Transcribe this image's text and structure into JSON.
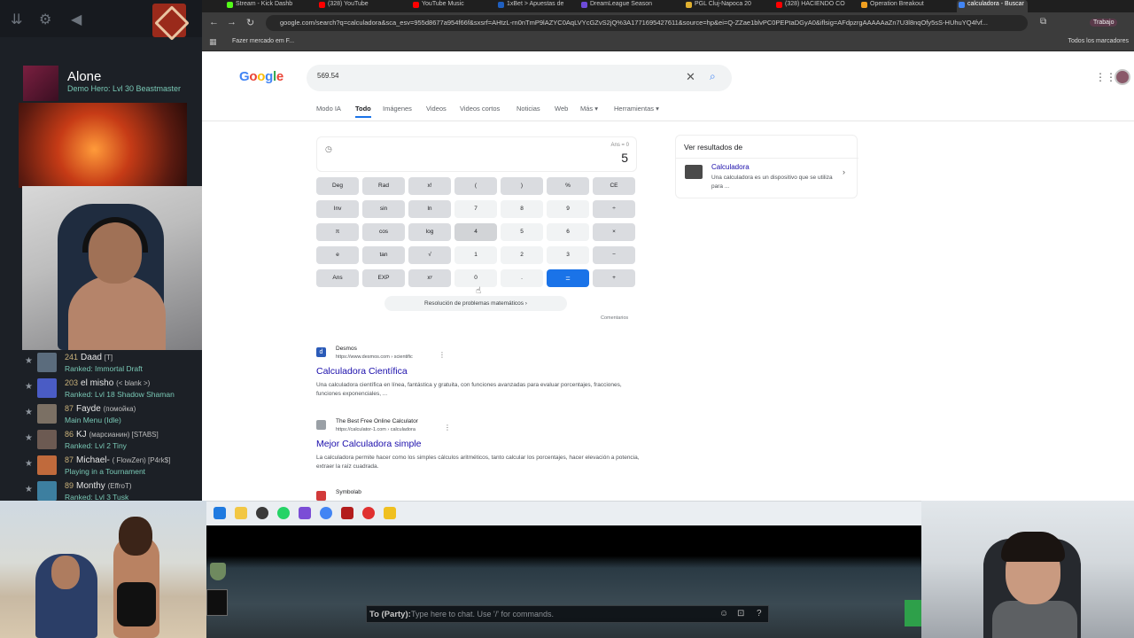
{
  "steam": {
    "profile": {
      "name": "Alone",
      "status": "Demo Hero: Lvl 30 Beastmaster"
    },
    "friends": [
      {
        "level": "241",
        "name": "Daad",
        "tag": "[T]",
        "status": "Ranked: Immortal Draft",
        "color": "#5b6c7d"
      },
      {
        "level": "203",
        "name": "el misho",
        "tag": "(< blank >)",
        "status": "Ranked: Lvl 18 Shadow Shaman",
        "color": "#4a5cc5"
      },
      {
        "level": "87",
        "name": "Fayde",
        "tag": "(помойка)",
        "status": "Main Menu (Idle)",
        "color": "#7b7064"
      },
      {
        "level": "86",
        "name": "KJ",
        "tag": "(марсианин) [STABS]",
        "status": "Ranked: Lvl 2 Tiny",
        "color": "#6c5a52"
      },
      {
        "level": "87",
        "name": "Michael-",
        "tag": "( FlowZen) [P4rk$]",
        "status": "Playing in a Tournament",
        "color": "#c06a3c"
      },
      {
        "level": "89",
        "name": "Monthy",
        "tag": "(EffroT)",
        "status": "Ranked: Lvl 3 Tusk",
        "color": "#3d7fa0"
      }
    ]
  },
  "browser": {
    "tabs": [
      {
        "label": "Stream - Kick Dashb",
        "color": "#53fc18",
        "active": false
      },
      {
        "label": "(328) YouTube",
        "color": "#ff0000",
        "active": false
      },
      {
        "label": "YouTube Music",
        "color": "#ff0000",
        "active": false
      },
      {
        "label": "1xBet > Apuestas de",
        "color": "#1f5fbf",
        "active": false
      },
      {
        "label": "DreamLeague Season",
        "color": "#6e4bd8",
        "active": false
      },
      {
        "label": "PGL Cluj-Napoca 20",
        "color": "#e0b030",
        "active": false
      },
      {
        "label": "(328) HACIENDO CO",
        "color": "#ff0000",
        "active": false
      },
      {
        "label": "Operation Breakout",
        "color": "#f0a020",
        "active": false
      },
      {
        "label": "calculadora - Buscar",
        "color": "#4285f4",
        "active": true
      }
    ],
    "url": "google.com/search?q=calculadora&sca_esv=955d8677a954f66f&sxsrf=AHtzL-rn0nTmP9lAZYC0AqLVYcGZvS2jQ%3A1771695427611&source=hp&ei=Q-ZZae1blvPC0PEPtaDGyA0&iflsig=AFdpzrgAAAAAaZn7U3l8nqOfy5sS-HUhuYQ4fvf...",
    "profile_chip": "Trabajo",
    "bookmark": "Fazer mercado em F...",
    "bookmark_all": "Todos los marcadores"
  },
  "google": {
    "logo": [
      "G",
      "o",
      "o",
      "g",
      "l",
      "e"
    ],
    "query": "569.54",
    "tabs": [
      "Modo IA",
      "Todo",
      "Imágenes",
      "Videos",
      "Videos cortos",
      "Noticias",
      "Web",
      "Más ▾",
      "Herramientas ▾"
    ],
    "active_tab": "Todo",
    "calculator": {
      "ans": "Ans = 0",
      "value": "5",
      "keys": [
        [
          "Deg",
          "Rad",
          "x!",
          "(",
          ")",
          "%",
          "CE"
        ],
        [
          "Inv",
          "sin",
          "ln",
          "7",
          "8",
          "9",
          "÷"
        ],
        [
          "π",
          "cos",
          "log",
          "4",
          "5",
          "6",
          "×"
        ],
        [
          "e",
          "tan",
          "√",
          "1",
          "2",
          "3",
          "−"
        ],
        [
          "Ans",
          "EXP",
          "xʸ",
          "0",
          ".",
          "=",
          "+"
        ]
      ],
      "solve_label": "Resolución de problemas matemáticos",
      "feedback": "Comentarios"
    },
    "results": [
      {
        "site": "Desmos",
        "url": "https://www.desmos.com › scientific",
        "title": "Calculadora Científica",
        "snippet": "Una calculadora científica en línea, fantástica y gratuita, con funciones avanzadas para evaluar porcentajes, fracciones, funciones exponenciales, ...",
        "color": "#2b5bb8",
        "letter": "d"
      },
      {
        "site": "The Best Free Online Calculator",
        "url": "https://calculator-1.com › calculadora",
        "title": "Mejor Calculadora simple",
        "snippet": "La calculadora permite hacer como los simples cálculos aritméticos, tanto calcular los porcentajes, hacer elevación a potencia, extraer la raíz cuadrada.",
        "color": "#9aa0a6",
        "letter": ""
      },
      {
        "site": "Symbolab",
        "url": "",
        "title": "",
        "snippet": "",
        "color": "#d23a3a",
        "letter": ""
      }
    ],
    "knowledge_panel": {
      "header": "Ver resultados de",
      "title": "Calculadora",
      "description": "Una calculadora es un dispositivo que se utiliza para ..."
    }
  },
  "game": {
    "chat_label": "To (Party):",
    "chat_placeholder": "Type here to chat. Use '/' for commands."
  }
}
